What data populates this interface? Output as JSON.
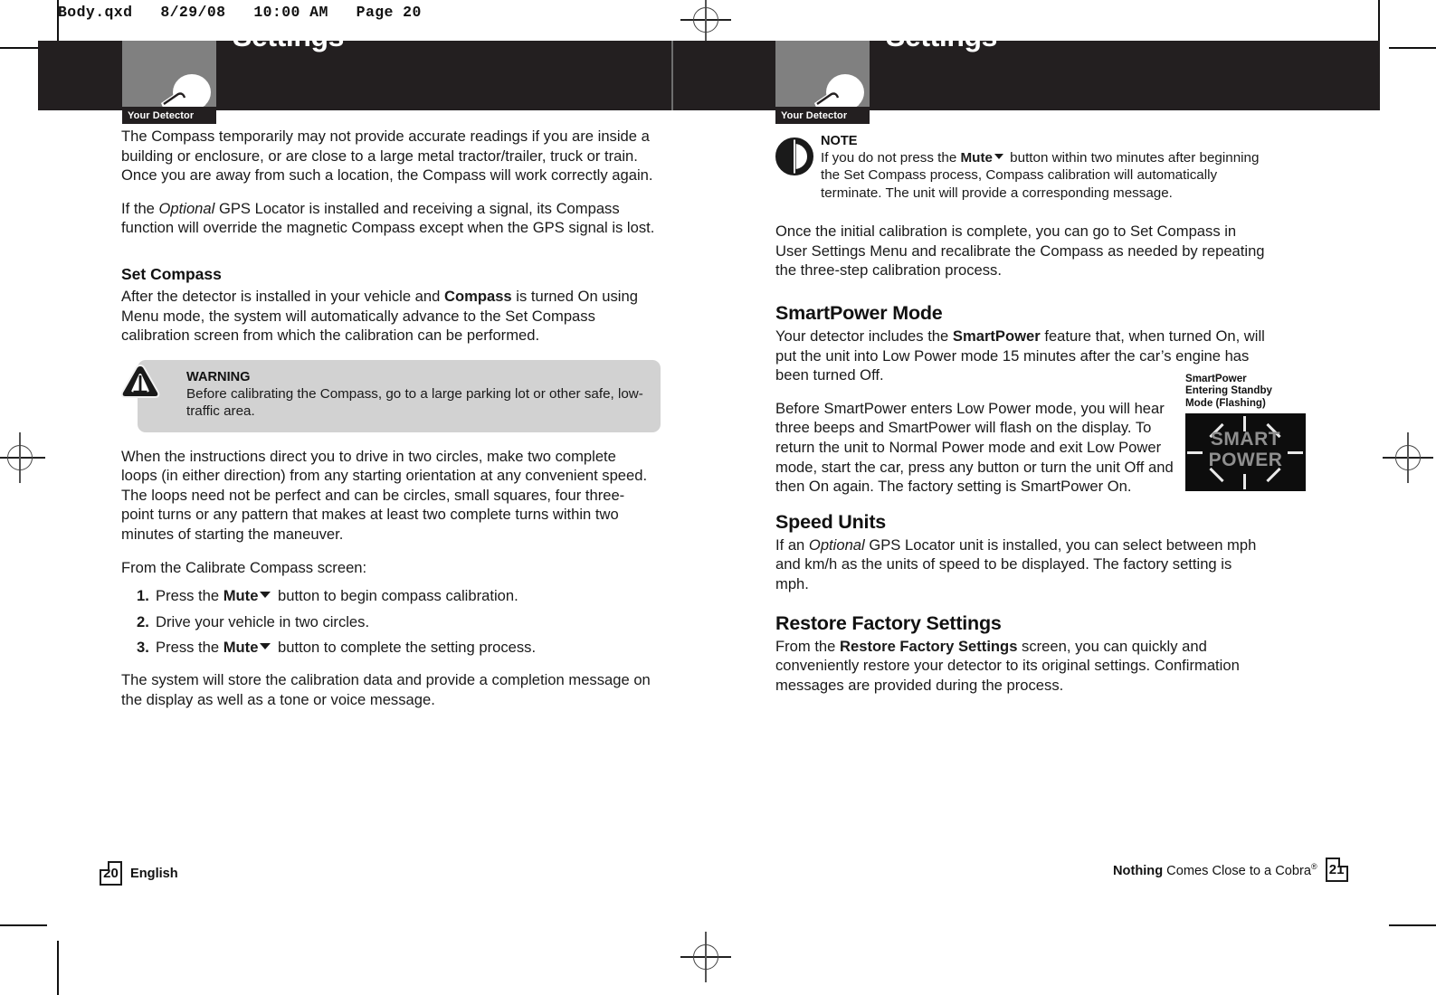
{
  "slug": "Body.qxd   8/29/08   10:00 AM   Page 20",
  "colors": {
    "header_black": "#231f20",
    "chapmark_gray": "#808080",
    "callout_gray": "#d2d2d2",
    "lcd_black": "#0d0d0d",
    "lcd_text_gray": "#8f8f8f"
  },
  "header": {
    "chapter_title": "Settings",
    "detector_tag": "Your Detector"
  },
  "left_page": {
    "paragraphs": [
      "The Compass temporarily may not provide accurate readings if you are inside a building or enclosure, or are close to a large metal tractor/trailer, truck or train. Once you are away from such a location, the Compass will work correctly again."
    ],
    "gps_para": {
      "before": "If the ",
      "italic": "Optional",
      "after": " GPS Locator is installed and receiving a signal, its Compass function will override the magnetic Compass except when the GPS signal is lost."
    },
    "set_compass": {
      "heading": "Set Compass",
      "para": {
        "before": "After the detector is installed in your vehicle and ",
        "bold": "Compass",
        "after": " is turned On using Menu mode, the system will automatically advance to the Set Compass calibration screen from which the calibration can be performed."
      }
    },
    "warning": {
      "title": "WARNING",
      "text": "Before calibrating the Compass, go to a large parking lot or other safe, low-traffic area."
    },
    "loops_para": "When the instructions direct you to drive in two circles, make two complete loops (in either direction) from any starting orientation at any convenient speed. The loops need not be perfect and can be circles, small squares, four three-point turns or any pattern that makes at least two complete turns within two minutes of starting the maneuver.",
    "steps_intro": "From the Calibrate Compass screen:",
    "steps": [
      {
        "num": "1.",
        "before": "Press the ",
        "bold": "Mute",
        "after": " button to begin compass calibration.",
        "has_triangle": true
      },
      {
        "num": "2.",
        "before": "Drive your vehicle in two circles.",
        "bold": "",
        "after": "",
        "has_triangle": false
      },
      {
        "num": "3.",
        "before": "Press the ",
        "bold": "Mute",
        "after": " button to complete the setting process.",
        "has_triangle": true
      }
    ],
    "closing_para": "The system will store the calibration data and provide a completion message on the display as well as a tone or voice message."
  },
  "right_page": {
    "note": {
      "title": "NOTE",
      "before": "If you do not press the ",
      "bold": "Mute",
      "after": " button within two minutes after beginning the Set Compass process, Compass calibration will automatically terminate. The unit will provide a corresponding message."
    },
    "recalibrate_para": "Once the initial calibration is complete, you can go to Set Compass in User Settings Menu and recalibrate the Compass as needed by repeating the three-step calibration process.",
    "smartpower": {
      "heading": "SmartPower Mode",
      "para": {
        "before": "Your detector includes the ",
        "bold": "SmartPower",
        "after": " feature that, when turned On, will put the unit into Low Power mode 15 minutes after the car’s engine has been turned Off."
      },
      "para2": "Before SmartPower enters Low Power mode, you will hear three beeps and SmartPower will flash on the display. To return the unit to Normal Power mode and exit Low Power mode, start the car, press any button or turn the unit Off and then On again. The factory setting is SmartPower On."
    },
    "figure": {
      "caption": "SmartPower\nEntering Standby\nMode (Flashing)",
      "lcd_line1": "SMART",
      "lcd_line2": "POWER"
    },
    "speed_units": {
      "heading": "Speed Units",
      "before": "If an ",
      "italic": "Optional",
      "after": " GPS Locator unit is installed, you can select between mph and km/h as the units of speed to be displayed. The factory setting is mph."
    },
    "restore": {
      "heading": "Restore Factory Settings",
      "before": "From the ",
      "bold": "Restore Factory Settings",
      "after": " screen, you can quickly and conveniently restore your detector to its original settings. Confirmation messages are provided during the process."
    }
  },
  "footer": {
    "left_page_number": "20",
    "left_language": "English",
    "tagline_bold": "Nothing",
    "tagline_rest": " Comes Close to a Cobra",
    "tagline_reg": "®",
    "right_page_number": "21"
  }
}
